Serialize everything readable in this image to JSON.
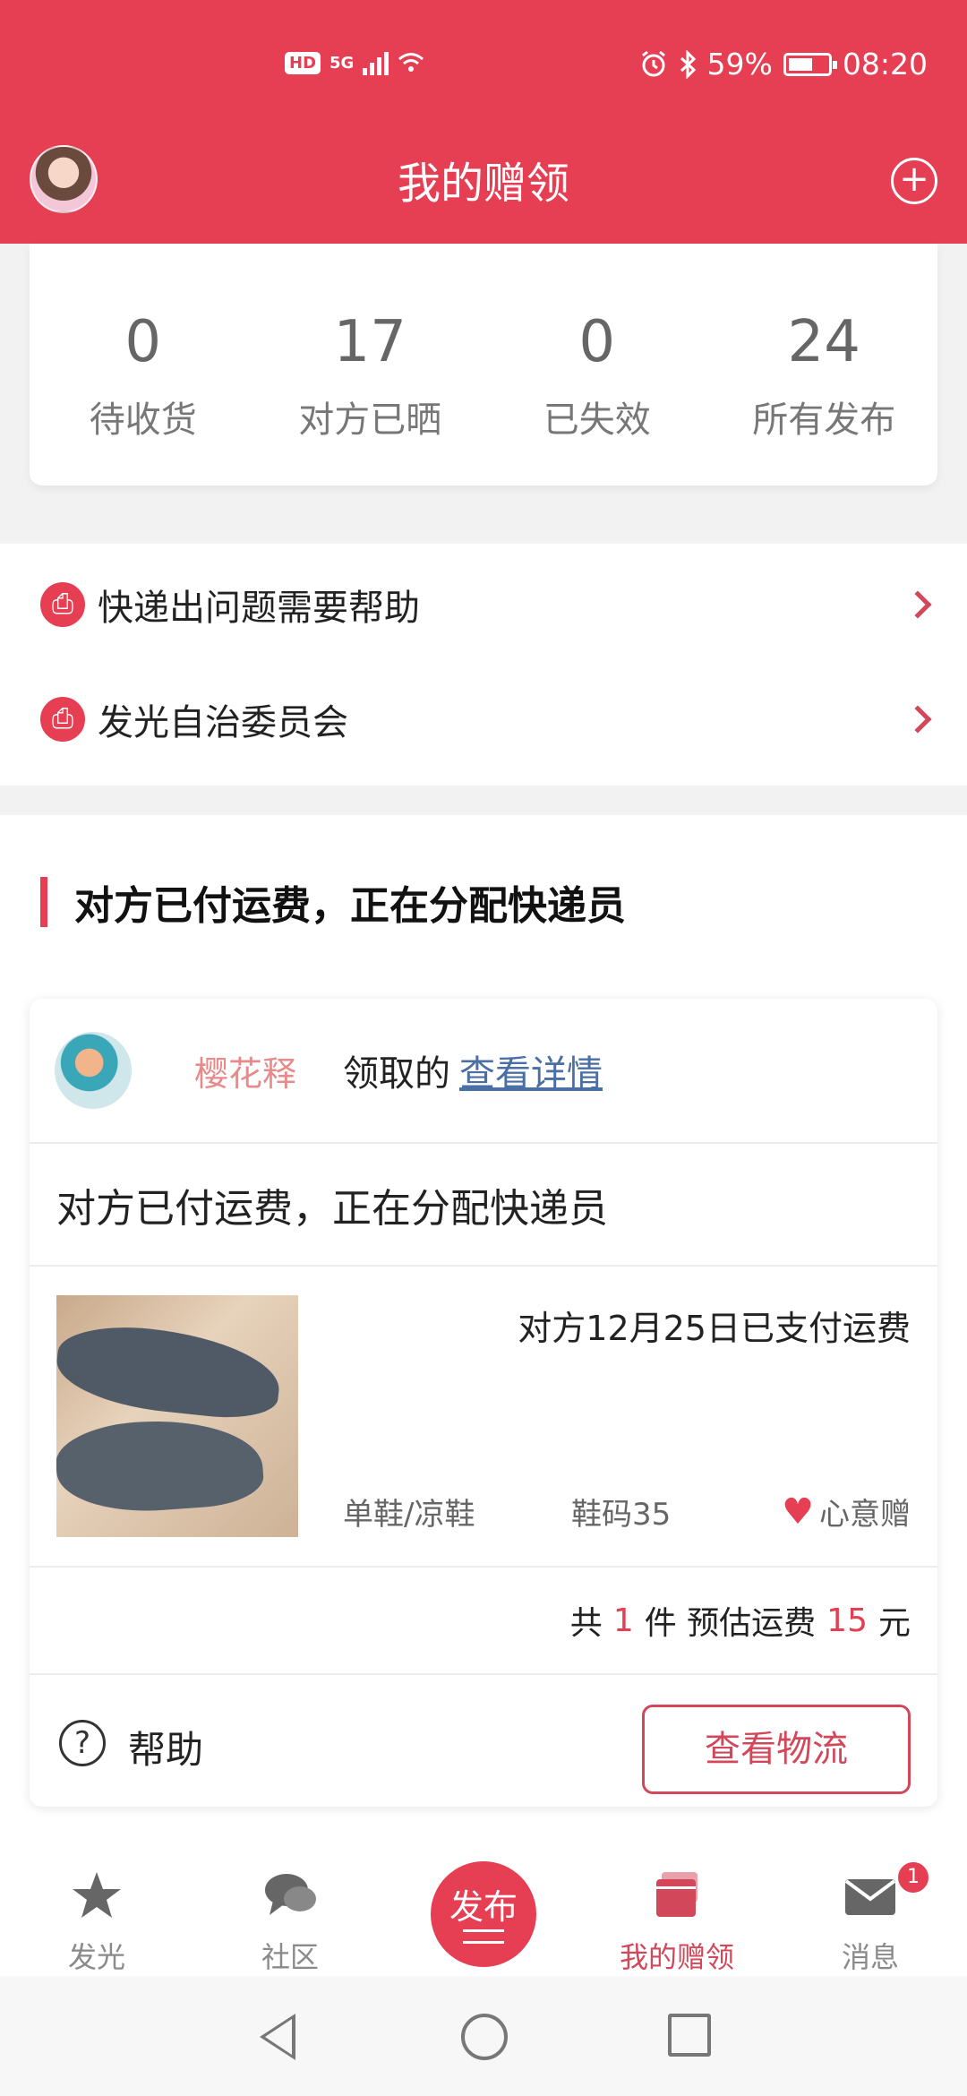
{
  "status_bar": {
    "hd": "HD",
    "network": "5G",
    "battery": "59%",
    "time": "08:20"
  },
  "header": {
    "title": "我的赠领",
    "add_icon": "plus-circle-icon",
    "avatar_icon": "avatar"
  },
  "stats": [
    {
      "value": "0",
      "label": "待收货"
    },
    {
      "value": "17",
      "label": "对方已晒"
    },
    {
      "value": "0",
      "label": "已失效"
    },
    {
      "value": "24",
      "label": "所有发布"
    }
  ],
  "menu": [
    {
      "label": "快递出问题需要帮助",
      "icon": "help-desk-icon"
    },
    {
      "label": "发光自治委员会",
      "icon": "help-desk-icon"
    }
  ],
  "section": {
    "title": "对方已付运费，正在分配快递员"
  },
  "order": {
    "user_name": "樱花释",
    "claim_text": "领取的",
    "detail_link": "查看详情",
    "status": "对方已付运费，正在分配快递员",
    "paid_text": "对方12月25日已支付运费",
    "item_type": "单鞋/凉鞋",
    "item_size": "鞋码35",
    "love_label": "心意赠",
    "summary": {
      "prefix": "共",
      "count": "1",
      "middle": "件 预估运费",
      "fee": "15",
      "suffix": "元"
    },
    "help_label": "帮助",
    "logistics_button": "查看物流"
  },
  "bottom_nav": [
    {
      "label": "发光",
      "icon": "star-icon"
    },
    {
      "label": "社区",
      "icon": "chat-bubbles-icon"
    },
    {
      "label": "发布",
      "icon": "publish-icon"
    },
    {
      "label": "我的赠领",
      "icon": "cards-icon",
      "active": true
    },
    {
      "label": "消息",
      "icon": "mail-icon",
      "badge": "1"
    }
  ],
  "colors": {
    "brand": "#e63e52",
    "link": "#4a6fa5",
    "muted": "#8a8a8a"
  }
}
